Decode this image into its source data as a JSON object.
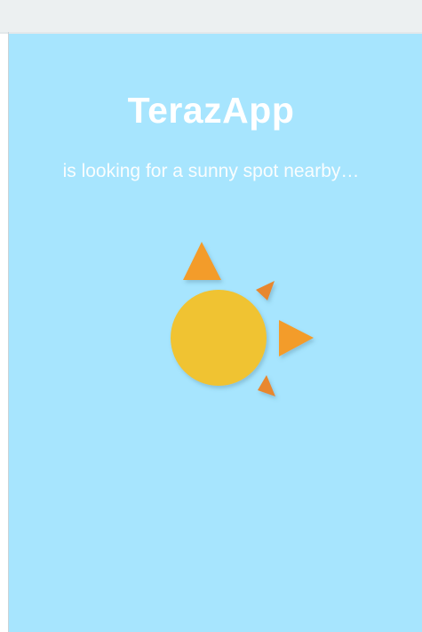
{
  "app": {
    "title": "TerazApp",
    "subtitle": "is looking for a sunny spot nearby…"
  },
  "colors": {
    "background": "#a7e5fe",
    "sun": "#f0c330",
    "ray": "#f39c2c",
    "ray_dark": "#e8872e",
    "text": "#ffffff",
    "top_bar": "#ecf0f1"
  },
  "illustration": {
    "icon": "sun-icon"
  }
}
